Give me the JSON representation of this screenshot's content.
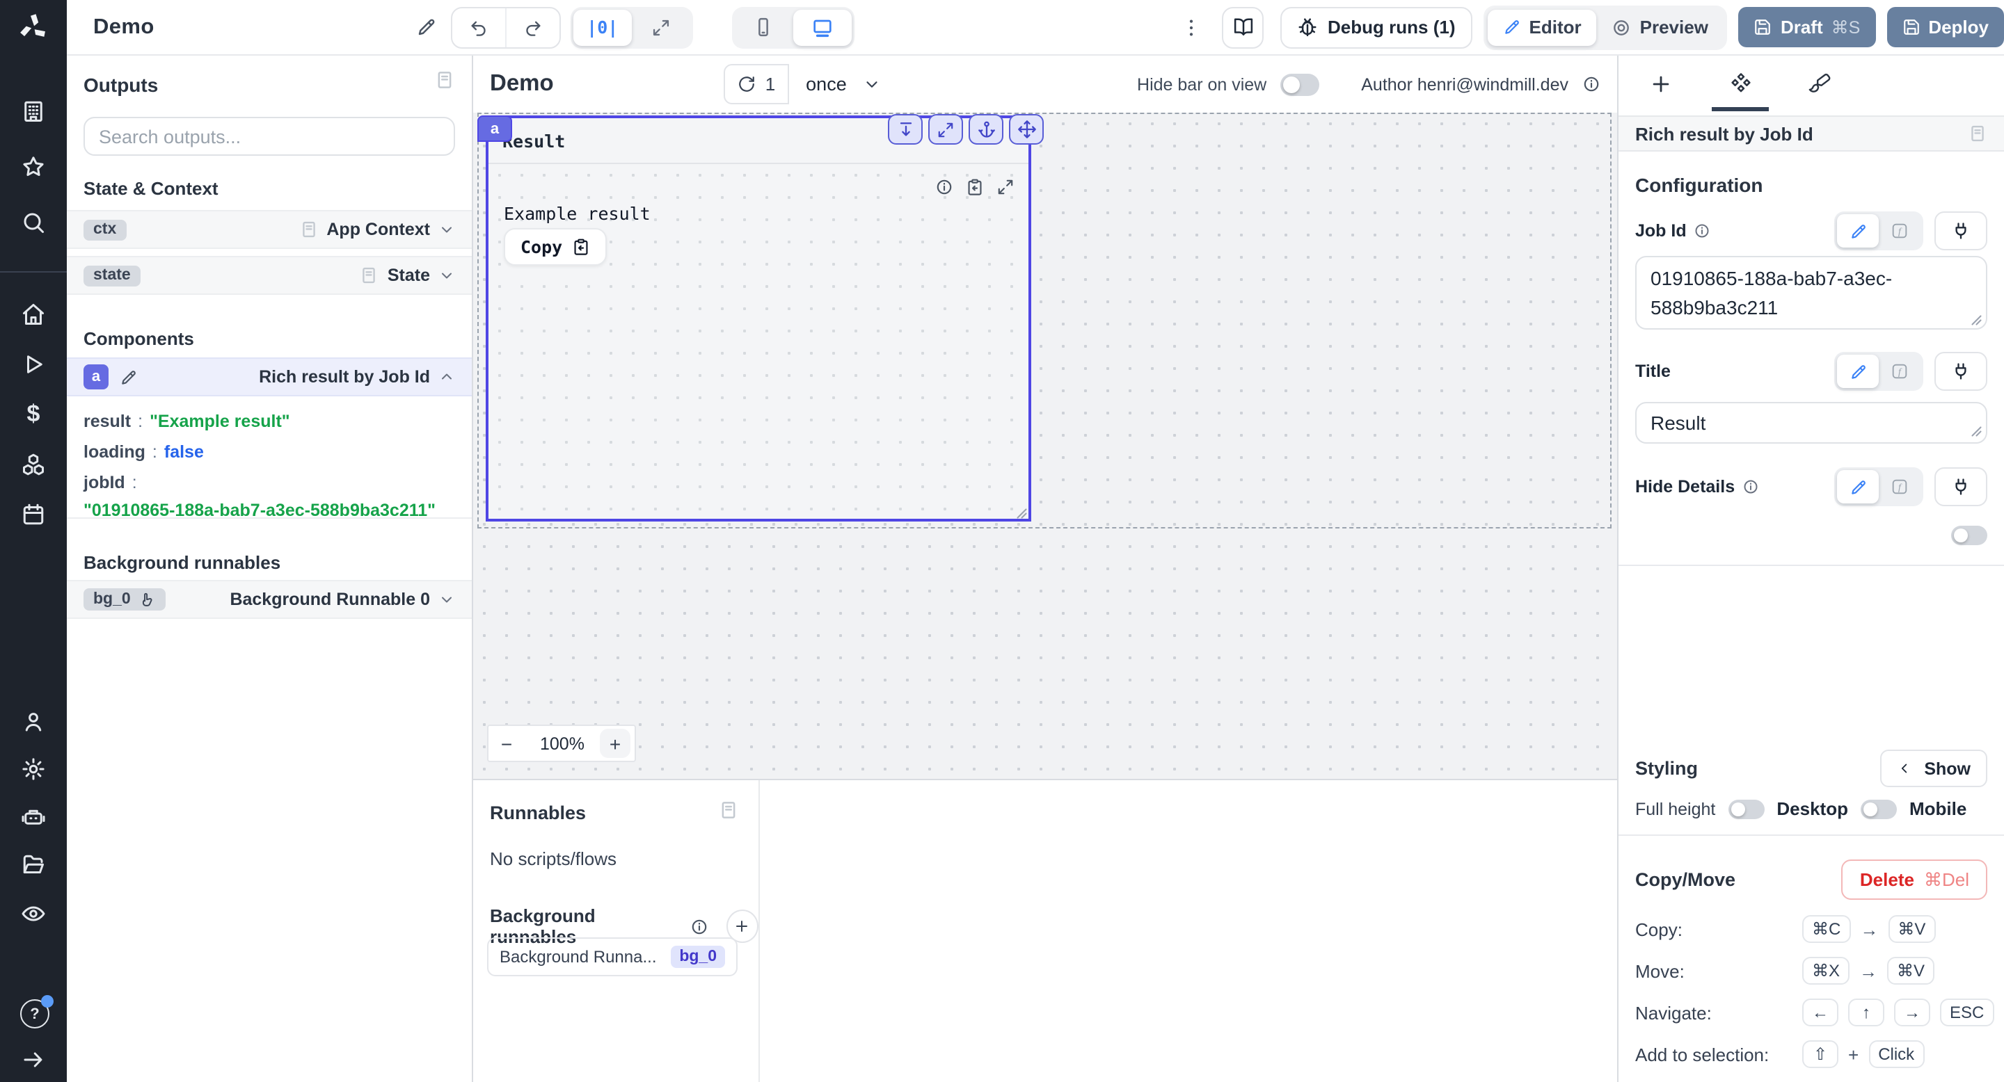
{
  "theme": {
    "rail_bg": "#1e232c",
    "accent_indigo": "#666be2",
    "selection_border": "#4f46e5",
    "primary_blue": "#3b82f6",
    "string_green": "#16a34a",
    "boolean_blue": "#2563eb",
    "slate_button": "#68809f",
    "delete_red": "#dc2626",
    "canvas_bg": "#f1f2f4"
  },
  "rail": {
    "icons": [
      "windmill-logo",
      "building",
      "star",
      "search",
      "home",
      "play",
      "dollar",
      "boxes",
      "calendar",
      "user",
      "settings",
      "robot",
      "folder",
      "eye",
      "help",
      "collapse-right"
    ]
  },
  "topbar": {
    "title": "Demo",
    "debug_runs": "Debug runs (1)",
    "editor": "Editor",
    "preview": "Preview",
    "draft": "Draft",
    "draft_shortcut": "⌘S",
    "deploy": "Deploy"
  },
  "outputs": {
    "title": "Outputs",
    "search_placeholder": "Search outputs...",
    "state_context_heading": "State & Context",
    "ctx_id": "ctx",
    "ctx_label": "App Context",
    "state_id": "state",
    "state_label": "State",
    "components_heading": "Components",
    "comp_id": "a",
    "comp_label": "Rich result by Job Id",
    "kv": {
      "k1": "result",
      "v1": "\"Example result\"",
      "k2": "loading",
      "v2": "false",
      "k3": "jobId",
      "v3": "\"01910865-188a-bab7-a3ec-588b9ba3c211\""
    },
    "background_heading": "Background runnables",
    "bg_id": "bg_0",
    "bg_label": "Background Runnable 0"
  },
  "canvas": {
    "title": "Demo",
    "run_count": "1",
    "run_mode": "once",
    "hide_bar_label": "Hide bar on view",
    "author_label": "Author henri@windmill.dev",
    "zoom_out": "−",
    "zoom_level": "100%",
    "zoom_in": "+",
    "comp_badge": "a",
    "comp_title": "Result",
    "comp_body": "Example result",
    "copy_label": "Copy"
  },
  "runnables": {
    "title": "Runnables",
    "empty": "No scripts/flows",
    "background_heading": "Background runnables",
    "item_label": "Background Runna...",
    "item_id": "bg_0"
  },
  "settings": {
    "header": "Rich result by Job Id",
    "configuration": "Configuration",
    "job_id_label": "Job Id",
    "job_id_value": "01910865-188a-bab7-a3ec-588b9ba3c211",
    "title_label": "Title",
    "title_value": "Result",
    "hide_details_label": "Hide Details",
    "styling": "Styling",
    "show": "Show",
    "full_height": "Full height",
    "desktop": "Desktop",
    "mobile": "Mobile",
    "copy_move": "Copy/Move",
    "delete": "Delete",
    "delete_shortcut": "⌘Del",
    "copy_label": "Copy:",
    "copy_k1": "⌘C",
    "copy_arrow": "→",
    "copy_k2": "⌘V",
    "move_label": "Move:",
    "move_k1": "⌘X",
    "move_arrow": "→",
    "move_k2": "⌘V",
    "nav_label": "Navigate:",
    "nav_k1": "←",
    "nav_k2": "↑",
    "nav_k3": "→",
    "nav_k4": "ESC",
    "add_label": "Add to selection:",
    "add_k1": "⇧",
    "add_plus": "+",
    "add_k2": "Click"
  }
}
